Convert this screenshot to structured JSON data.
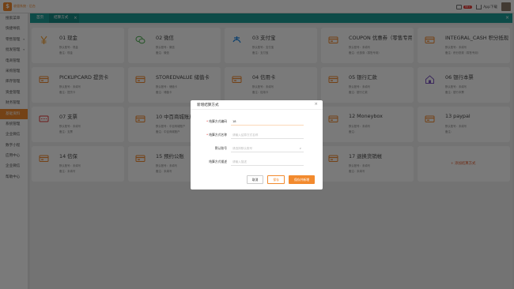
{
  "app": {
    "logo_char": "$",
    "logo_text": "收银系统 · 后台"
  },
  "topbar": {
    "badge": "99+",
    "downloads_label": "App下载",
    "messages_label": "消息"
  },
  "sidebar": {
    "items": [
      {
        "label": "搜索菜单",
        "caret": false,
        "active": false
      },
      {
        "label": "快捷导航",
        "caret": false,
        "active": false
      },
      {
        "label": "零售管理",
        "caret": true,
        "active": false
      },
      {
        "label": "批发管理",
        "caret": true,
        "active": false
      },
      {
        "label": "电商管理",
        "caret": false,
        "active": false
      },
      {
        "label": "采购管理",
        "caret": false,
        "active": false
      },
      {
        "label": "库存管理",
        "caret": false,
        "active": false
      },
      {
        "label": "资金管理",
        "caret": false,
        "active": false
      },
      {
        "label": "财务管理",
        "caret": false,
        "active": false
      },
      {
        "label": "基础资料",
        "caret": false,
        "active": true
      },
      {
        "label": "系统管理",
        "caret": false,
        "active": false
      },
      {
        "label": "企业微信",
        "caret": false,
        "active": false
      },
      {
        "label": "数字小程",
        "caret": false,
        "active": false
      },
      {
        "label": "应用中心",
        "caret": false,
        "active": false
      },
      {
        "label": "企业微信",
        "caret": false,
        "active": false
      },
      {
        "label": "帮助中心",
        "caret": false,
        "active": false
      }
    ]
  },
  "tabs": [
    {
      "label": "首页"
    },
    {
      "label": "结算方式"
    }
  ],
  "cards": [
    {
      "title": "01 现金",
      "line1": "默认账号：现金",
      "line2": "备注：现金",
      "icon": "yen-icon",
      "color": "#f5a33a"
    },
    {
      "title": "02 微信",
      "line1": "默认账号：微信",
      "line2": "备注：微信",
      "icon": "wechat-icon",
      "color": "#4caf50"
    },
    {
      "title": "03 支付宝",
      "line1": "默认账号：支付宝",
      "line2": "备注：支付宝",
      "icon": "alipay-icon",
      "color": "#1e88e5"
    },
    {
      "title": "COUPON 优惠券（零售专用）",
      "line1": "默认账号：未填写",
      "line2": "备注：优惠券（零售专用）",
      "icon": "coupon-icon",
      "color": "#f28a2e"
    },
    {
      "title": "INTEGRAL_CASH 积分抵现",
      "line1": "默认账号：未填写",
      "line2": "备注：积分抵现（零售专用）",
      "icon": "points-icon",
      "color": "#f28a2e"
    },
    {
      "title": "PICKUPCARD 提货卡",
      "line1": "默认账号：未填写",
      "line2": "备注：提货卡",
      "icon": "card-icon",
      "color": "#f28a2e"
    },
    {
      "title": "STOREDVALUE 储值卡",
      "line1": "默认账号：储值卡",
      "line2": "备注：储值卡",
      "icon": "card-icon",
      "color": "#f28a2e"
    },
    {
      "title": "04 信用卡",
      "line1": "默认账号：未填写",
      "line2": "备注：信用卡",
      "icon": "card-icon",
      "color": "#f28a2e"
    },
    {
      "title": "05 银行汇款",
      "line1": "默认账号：未填写",
      "line2": "备注：银行汇款",
      "icon": "bank-icon",
      "color": "#f28a2e"
    },
    {
      "title": "06 银行本票",
      "line1": "默认账号：未填写",
      "line2": "备注：银行本票",
      "icon": "house-icon",
      "color": "#7e57c2"
    },
    {
      "title": "07 支票",
      "line1": "默认账号：未填写",
      "line2": "备注：支票",
      "icon": "cheque-icon",
      "color": "#e53935"
    },
    {
      "title": "10 中百商城账户",
      "line1": "默认账号：中百商城账户",
      "line2": "备注：中百商城账户",
      "icon": "card-icon",
      "color": "#f28a2e"
    },
    {
      "title": "",
      "line1": "",
      "line2": "",
      "icon": "card-icon",
      "color": "#f28a2e"
    },
    {
      "title": "12 Moneybox",
      "line1": "默认账号：未填写",
      "line2": "备注：",
      "icon": "card-icon",
      "color": "#f28a2e"
    },
    {
      "title": "13 paypal",
      "line1": "默认账号：未填写",
      "line2": "备注：",
      "icon": "card-icon",
      "color": "#f28a2e"
    },
    {
      "title": "14 信保",
      "line1": "默认账号：未填写",
      "line2": "备注：未填写",
      "icon": "card-icon",
      "color": "#f28a2e"
    },
    {
      "title": "15 预约公账",
      "line1": "默认账号：未填写",
      "line2": "备注：未填写",
      "icon": "card-icon",
      "color": "#f28a2e"
    },
    {
      "title": "",
      "line1": "",
      "line2": "",
      "icon": "card-icon",
      "color": "#f28a2e"
    },
    {
      "title": "17 退换货销帐",
      "line1": "默认账号：未填写",
      "line2": "备注：未填写",
      "icon": "card-icon",
      "color": "#f28a2e"
    }
  ],
  "add_card_label": "+ 添加结算方式",
  "modal": {
    "title": "新增结算方式",
    "close": "×",
    "fields": [
      {
        "label": "结算方式编码",
        "required": true,
        "value": "18",
        "placeholder": ""
      },
      {
        "label": "结算方式名称",
        "required": true,
        "value": "",
        "placeholder": "请输入结算方式名称"
      },
      {
        "label": "默认账号",
        "required": false,
        "value": "",
        "placeholder": "请选择默认账号"
      },
      {
        "label": "结算方式描述",
        "required": false,
        "value": "",
        "placeholder": "请输入描述"
      }
    ],
    "buttons": {
      "cancel": "取消",
      "save": "保存",
      "save_new": "保存并新增"
    }
  }
}
